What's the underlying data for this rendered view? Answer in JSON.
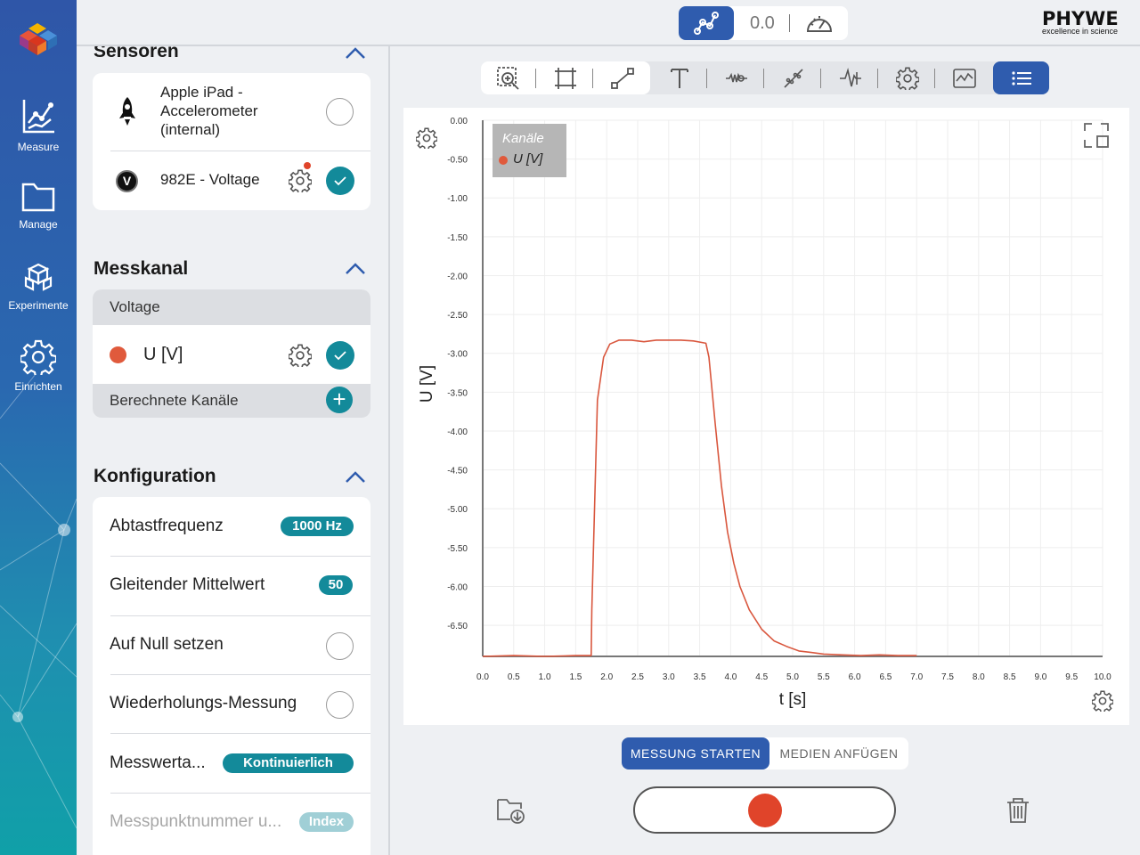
{
  "nav": {
    "items": [
      {
        "label": "Measure",
        "icon": "chart-line-icon"
      },
      {
        "label": "Manage",
        "icon": "folder-icon"
      },
      {
        "label": "Experimente",
        "icon": "cubes-icon"
      },
      {
        "label": "Einrichten",
        "icon": "gear-icon"
      }
    ]
  },
  "topbar": {
    "readout": "0.0",
    "brand": "PHYWE",
    "brand_tagline": "excellence in science"
  },
  "sensoren": {
    "title": "Sensoren",
    "items": [
      {
        "name": "Apple iPad -\nAccelerometer\n(internal)",
        "selected": false
      },
      {
        "name": "982E - Voltage",
        "badge": "V",
        "selected": true
      }
    ]
  },
  "messkanal": {
    "title": "Messkanal",
    "group": "Voltage",
    "channel": "U [V]",
    "channel_color": "#e05a3c",
    "calculated": "Berechnete Kanäle"
  },
  "konfiguration": {
    "title": "Konfiguration",
    "items": [
      {
        "label": "Abtastfrequenz",
        "value": "1000 Hz"
      },
      {
        "label": "Gleitender Mittelwert",
        "value": "50"
      },
      {
        "label": "Auf Null setzen",
        "checked": false
      },
      {
        "label": "Wiederholungs-Messung",
        "checked": false
      },
      {
        "label": "Messwerta...",
        "value": "Kontinuierlich"
      },
      {
        "label": "Messpunktnummer u...",
        "value": "Index"
      }
    ]
  },
  "chart_data": {
    "type": "line",
    "legend_title": "Kanäle",
    "legend_position": "top-left",
    "grid": true,
    "xlabel": "t [s]",
    "ylabel": "U [V]",
    "xlim": [
      0.0,
      10.0
    ],
    "ylim": [
      -6.9,
      0.0
    ],
    "xticks": [
      "0.0",
      "0.5",
      "1.0",
      "1.5",
      "2.0",
      "2.5",
      "3.0",
      "3.5",
      "4.0",
      "4.5",
      "5.0",
      "5.5",
      "6.0",
      "6.5",
      "7.0",
      "7.5",
      "8.0",
      "8.5",
      "9.0",
      "9.5",
      "10.0"
    ],
    "yticks": [
      "0.00",
      "-0.50",
      "-1.00",
      "-1.50",
      "-2.00",
      "-2.50",
      "-3.00",
      "-3.50",
      "-4.00",
      "-4.50",
      "-5.00",
      "-5.50",
      "-6.00",
      "-6.50"
    ],
    "series": [
      {
        "name": "U [V]",
        "color": "#d9573e",
        "x": [
          0.0,
          0.5,
          1.0,
          1.5,
          1.75,
          1.76,
          1.85,
          1.95,
          2.05,
          2.2,
          2.4,
          2.6,
          2.8,
          3.0,
          3.2,
          3.4,
          3.6,
          3.65,
          3.75,
          3.85,
          3.95,
          4.05,
          4.15,
          4.3,
          4.5,
          4.7,
          4.9,
          5.1,
          5.3,
          5.5,
          5.8,
          6.1,
          6.4,
          6.7,
          7.0
        ],
        "y": [
          -6.9,
          -6.89,
          -6.9,
          -6.89,
          -6.89,
          -6.3,
          -3.6,
          -3.05,
          -2.88,
          -2.83,
          -2.83,
          -2.85,
          -2.83,
          -2.83,
          -2.83,
          -2.84,
          -2.87,
          -3.05,
          -3.9,
          -4.7,
          -5.3,
          -5.7,
          -6.0,
          -6.3,
          -6.55,
          -6.7,
          -6.77,
          -6.83,
          -6.85,
          -6.87,
          -6.88,
          -6.89,
          -6.88,
          -6.89,
          -6.89
        ]
      }
    ]
  },
  "actions": {
    "start": "MESSUNG STARTEN",
    "media": "MEDIEN ANFÜGEN"
  }
}
